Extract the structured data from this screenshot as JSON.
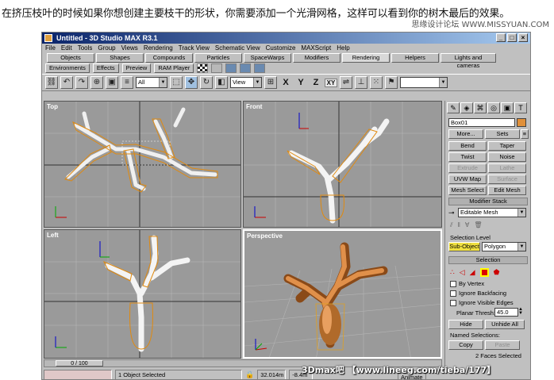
{
  "caption": "在挤压枝叶的时候如果你想创建主要枝干的形状，你需要添加一个光滑网格，这样可以看到你的树木最后的效果。",
  "watermark_top": "思缘设计论坛 WWW.MISSYUAN.COM",
  "window": {
    "title": "Untitled - 3D Studio MAX R3.1",
    "buttons": [
      "_",
      "□",
      "×"
    ]
  },
  "menu": [
    "File",
    "Edit",
    "Tools",
    "Group",
    "Views",
    "Rendering",
    "Track View",
    "Schematic View",
    "Customize",
    "MAXScript",
    "Help"
  ],
  "tabs": [
    "Objects",
    "Shapes",
    "Compounds",
    "Particles",
    "SpaceWarps",
    "Modifiers",
    "Rendering",
    "Helpers",
    "Lights and cameras"
  ],
  "active_tab": "Rendering",
  "render_buttons": [
    "Environments",
    "Effects",
    "Preview",
    "RAM Player"
  ],
  "toolbar": {
    "selection_filter": "All",
    "ref_coord": "View",
    "axes": [
      "X",
      "Y",
      "Z",
      "XY"
    ]
  },
  "viewports": {
    "top": "Top",
    "front": "Front",
    "left": "Left",
    "perspective": "Perspective"
  },
  "timeline": {
    "frame": "0 / 100"
  },
  "command_panel": {
    "object_name": "Box01",
    "btn_more": "More...",
    "btn_sets": "Sets",
    "modifiers": [
      "Bend",
      "Taper",
      "Twist",
      "Noise",
      "Extrude",
      "Lathe",
      "UVW Map",
      "Surface",
      "Mesh Select",
      "Edit Mesh"
    ],
    "modifier_stack_title": "Modifier Stack",
    "stack_value": "Editable Mesh",
    "selection_level_label": "Selection Level",
    "sub_object": "Sub-Object",
    "level_value": "Polygon",
    "selection_title": "Selection",
    "by_vertex": "By Vertex",
    "ignore_backfacing": "Ignore Backfacing",
    "ignore_visible_edges": "Ignore Visible Edges",
    "planar_thresh_label": "Planar Thresh:",
    "planar_thresh_value": "45.0",
    "hide": "Hide",
    "unhide_all": "Unhide All",
    "named_selections": "Named Selections:",
    "copy": "Copy",
    "paste": "Paste",
    "faces_selected": "2 Faces Selected"
  },
  "status": {
    "selected": "1 Object Selected",
    "coord1": "32.014m",
    "coord2": "-8.4m",
    "animate": "Animate"
  },
  "watermark_bottom": "3Dmax吧 【www.lineeg.com/tieba/177】"
}
